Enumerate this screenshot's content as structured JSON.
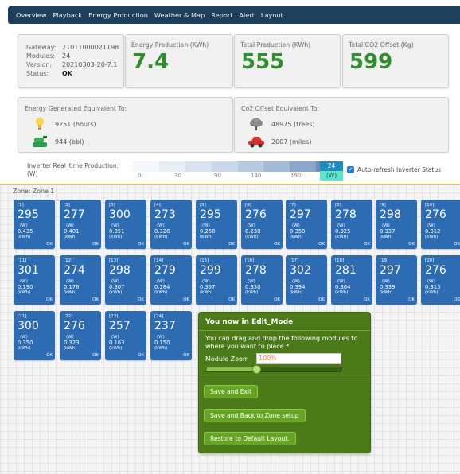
{
  "nav": {
    "items": [
      "Overview",
      "Playback",
      "Energy Production",
      "Weather & Map",
      "Report",
      "Alert",
      "Layout"
    ]
  },
  "gateway": {
    "gateway_label": "Gateway:",
    "gateway_value": "21011000021198",
    "modules_label": "Modules:",
    "modules_value": "24",
    "version_label": "Version:",
    "version_value": "20210303-20-7.1",
    "status_label": "Status:",
    "status_value": "OK"
  },
  "stats": {
    "energy": {
      "label": "Energy Production (KWh)",
      "value": "7.4"
    },
    "total": {
      "label": "Total Production (KWh)",
      "value": "555"
    },
    "co2": {
      "label": "Total CO2 Offset (Kg)",
      "value": "599"
    }
  },
  "equivalents": {
    "energy_title": "Energy Generated Equivalent To:",
    "hours": "9251 (hours)",
    "bbl": "944 (bbl)",
    "co2_title": "Co2 Offset Equivalent To:",
    "trees": "48975 (trees)",
    "miles": "2007 (miles)"
  },
  "legend": {
    "label_line1": "Inverter Real_time Production:",
    "label_line2": "(W)",
    "ticks": [
      "0",
      "30",
      "90",
      "140",
      "190"
    ],
    "current_value": "24",
    "current_unit": "(W)",
    "gradient_colors": [
      "#f3f6fa",
      "#e6edf5",
      "#d8e3ef",
      "#c9d8ea",
      "#b8cbe2",
      "#a3bad8",
      "#8aa6cc",
      "#6d8fbe"
    ],
    "autorefresh_label": "Auto-refresh Inverter Status",
    "autorefresh_checked": true
  },
  "zone": {
    "label": "Zone: Zone 1"
  },
  "modules": [
    {
      "id": "[1]",
      "w": "295",
      "kwh": "0.435"
    },
    {
      "id": "[2]",
      "w": "277",
      "kwh": "0.401"
    },
    {
      "id": "[3]",
      "w": "300",
      "kwh": "0.351"
    },
    {
      "id": "[4]",
      "w": "273",
      "kwh": "0.326"
    },
    {
      "id": "[5]",
      "w": "295",
      "kwh": "0.258"
    },
    {
      "id": "[6]",
      "w": "276",
      "kwh": "0.238"
    },
    {
      "id": "[7]",
      "w": "297",
      "kwh": "0.350"
    },
    {
      "id": "[8]",
      "w": "278",
      "kwh": "0.325"
    },
    {
      "id": "[9]",
      "w": "298",
      "kwh": "0.337"
    },
    {
      "id": "[10]",
      "w": "276",
      "kwh": "0.312"
    },
    {
      "id": "[11]",
      "w": "301",
      "kwh": "0.190"
    },
    {
      "id": "[12]",
      "w": "274",
      "kwh": "0.176"
    },
    {
      "id": "[13]",
      "w": "298",
      "kwh": "0.307"
    },
    {
      "id": "[14]",
      "w": "279",
      "kwh": "0.284"
    },
    {
      "id": "[15]",
      "w": "299",
      "kwh": "0.357"
    },
    {
      "id": "[16]",
      "w": "278",
      "kwh": "0.330"
    },
    {
      "id": "[17]",
      "w": "302",
      "kwh": "0.394"
    },
    {
      "id": "[18]",
      "w": "281",
      "kwh": "0.364"
    },
    {
      "id": "[19]",
      "w": "297",
      "kwh": "0.339"
    },
    {
      "id": "[20]",
      "w": "276",
      "kwh": "0.313"
    },
    {
      "id": "[21]",
      "w": "300",
      "kwh": "0.350"
    },
    {
      "id": "[22]",
      "w": "276",
      "kwh": "0.323"
    },
    {
      "id": "[23]",
      "w": "257",
      "kwh": "0.163"
    },
    {
      "id": "[24]",
      "w": "237",
      "kwh": "0.150"
    }
  ],
  "module_units": {
    "w": "(W)",
    "kwh": "(kWh)",
    "status": "OK"
  },
  "edit_panel": {
    "title": "You now in Edit_Mode",
    "description": "You can drag and drop the following modules to where you want to place.*",
    "zoom_label": "Module Zoom",
    "zoom_value": "100%",
    "zoom_level": 0.37,
    "buttons": [
      "Save and Exit",
      "Save and Back to Zone setup",
      "Restore to Default Layout."
    ]
  },
  "colors": {
    "nav_bg": "#1c3f5e",
    "stat_green": "#2f8f2f",
    "module_blue": "#2d6bb3",
    "edit_panel_green": "#4d7a19",
    "current_badge": "#1e8cbd"
  },
  "icons": {
    "bulb": "lightbulb-icon",
    "oil": "oil-pump-icon",
    "tree": "tree-icon",
    "car": "car-icon",
    "checkbox": "checkbox-icon"
  }
}
